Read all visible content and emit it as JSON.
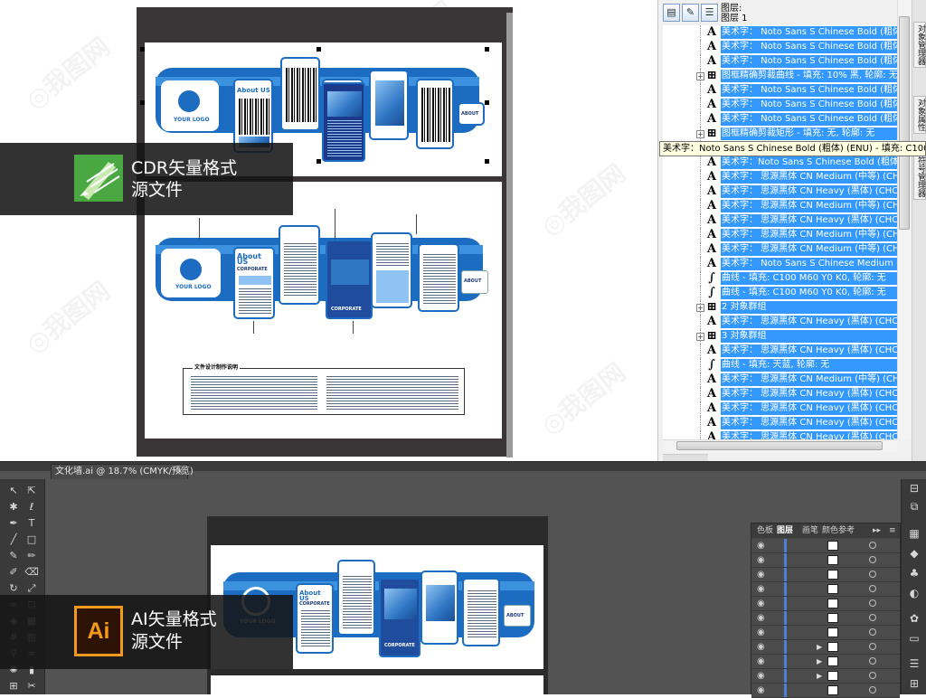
{
  "cdr": {
    "badge": {
      "line1": "CDR矢量格式",
      "line2": "源文件",
      "logo_icon": "coreldraw-pen-icon"
    },
    "object_manager": {
      "header_line1": "图层:",
      "header_line2": "图层 1",
      "tooltip": "美术字：Noto Sans S Chinese Bold (粗体) (ENU) - 填充: C100 M",
      "rows": [
        {
          "type": "text",
          "label": "美术字：  Noto Sans S Chinese Bold (粗体)"
        },
        {
          "type": "text",
          "label": "美术字：  Noto Sans S Chinese Bold (粗体)"
        },
        {
          "type": "text",
          "label": "美术字：  Noto Sans S Chinese Bold (粗体)"
        },
        {
          "type": "group",
          "label": "图框精确剪裁曲线 - 填充: 10% 黑, 轮廓: 无"
        },
        {
          "type": "text",
          "label": "美术字：  Noto Sans S Chinese Bold (粗体)"
        },
        {
          "type": "text",
          "label": "美术字：  Noto Sans S Chinese Bold (粗体)"
        },
        {
          "type": "text",
          "label": "美术字：  Noto Sans S Chinese Bold (粗体)"
        },
        {
          "type": "group",
          "label": "图框精确剪裁矩形 - 填充: 无, 轮廓: 无"
        },
        {
          "type": "group",
          "label": "3 对象群组"
        },
        {
          "type": "text",
          "label": "美术字：Noto Sans S Chinese Bold (粗体) (ENU) - 填充: C100 M"
        },
        {
          "type": "text",
          "label": "美术字：  思源黑体 CN Medium (中等) (CHC)"
        },
        {
          "type": "text",
          "label": "美术字：  思源黑体 CN Heavy (黑体) (CHC) -"
        },
        {
          "type": "text",
          "label": "美术字：  思源黑体 CN Medium (中等) (CHC)"
        },
        {
          "type": "text",
          "label": "美术字：  思源黑体 CN Heavy (黑体) (CHC) -"
        },
        {
          "type": "text",
          "label": "美术字：  思源黑体 CN Medium (中等) (CHC)"
        },
        {
          "type": "text",
          "label": "美术字：  思源黑体 CN Medium (中等) (CHC)"
        },
        {
          "type": "text",
          "label": "美术字：  Noto Sans S Chinese Medium (中"
        },
        {
          "type": "curve",
          "label": "曲线 - 填充: C100 M60 Y0 K0, 轮廓: 无"
        },
        {
          "type": "curve",
          "label": "曲线 - 填充: C100 M60 Y0 K0, 轮廓: 无"
        },
        {
          "type": "group",
          "label": "2 对象群组"
        },
        {
          "type": "text",
          "label": "美术字：  思源黑体 CN Heavy (黑体) (CHC) -"
        },
        {
          "type": "group",
          "label": "3 对象群组"
        },
        {
          "type": "text",
          "label": "美术字：  思源黑体 CN Heavy (黑体) (CHC) -"
        },
        {
          "type": "curve",
          "label": "曲线 - 填充: 天蓝, 轮廓: 无"
        },
        {
          "type": "text",
          "label": "美术字：  思源黑体 CN Medium (中等) (CHC)"
        },
        {
          "type": "text",
          "label": "美术字：  思源黑体 CN Heavy (黑体) (CHC) -"
        },
        {
          "type": "text",
          "label": "美术字：  思源黑体 CN Heavy (黑体) (CHC) -"
        },
        {
          "type": "text",
          "label": "美术字：  思源黑体 CN Heavy (黑体) (CHC) -"
        },
        {
          "type": "text",
          "label": "美术字：  思源黑体 CN Heavy (黑体) (CHC) -"
        },
        {
          "type": "text",
          "label": "美术字：  思源黑体 CN Heavy (黑体) (CHC) -"
        }
      ],
      "side_tabs": [
        "对象管理器",
        "对象属性",
        "符号管理器"
      ]
    },
    "design": {
      "logo_text": "YOUR LOGO",
      "about_us": "About US",
      "corporate": "CORPORATE",
      "about_small": "ABOUT",
      "info_box_title": "文件设计制作说明"
    }
  },
  "ai": {
    "badge": {
      "line1": "AI矢量格式",
      "line2": "源文件",
      "logo_text": "Ai"
    },
    "document_tab": "文化墙.ai @ 18.7% (CMYK/预览)",
    "close_glyph": "×",
    "layers_panel": {
      "tabs": [
        "色板",
        "图层",
        "画笔",
        "颜色参考"
      ],
      "menu_glyph": "▸▸",
      "row_count": 11
    }
  },
  "colors": {
    "brand_blue": "#1c6dc2",
    "selection": "#3399ff",
    "ai_orange": "#f39a1c",
    "cdr_green": "#49a842"
  }
}
